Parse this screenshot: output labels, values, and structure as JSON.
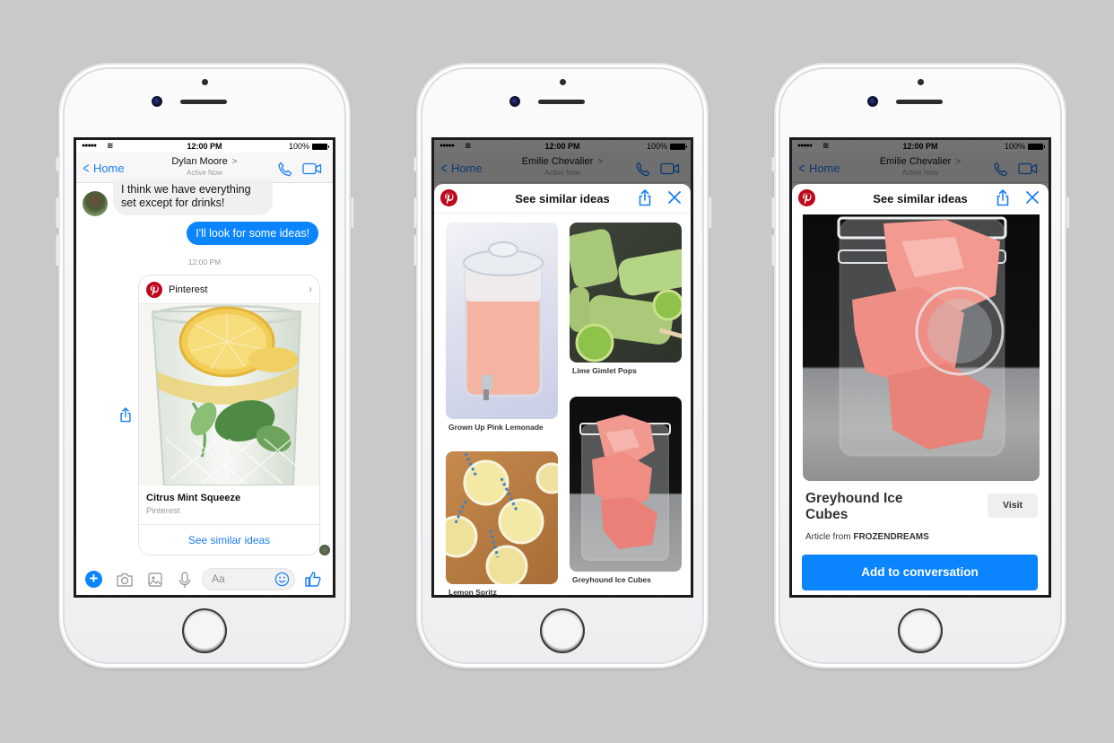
{
  "background_color": "#c9c9c9",
  "colors": {
    "messenger_blue": "#0a84ff",
    "link_blue": "#1a7ef4",
    "pinterest_red": "#bd081c",
    "bubble_gray": "#f1f0f0"
  },
  "phones": [
    {
      "status_bar": {
        "signal": "●●●●●",
        "wifi_icon": "wifi-icon",
        "time": "12:00 PM",
        "battery": "100%"
      },
      "nav": {
        "back_label": "Home",
        "contact_name": "Dylan Moore",
        "contact_arrow": ">",
        "status": "Active Now",
        "call_icon": "phone-icon",
        "video_icon": "video-camera-icon"
      },
      "messages": [
        {
          "direction": "incoming",
          "text": "I think we have everything set except for drinks!"
        },
        {
          "direction": "outgoing",
          "text": "I'll look for some ideas!"
        }
      ],
      "timestamp": "12:00 PM",
      "card": {
        "source_name": "Pinterest",
        "title": "Citrus Mint Squeeze",
        "subtitle": "Pinterest",
        "action_label": "See similar ideas",
        "image_description": "glass of water with lemon slices and mint leaves"
      },
      "composer": {
        "placeholder": "Aa",
        "icons": [
          "plus-icon",
          "camera-icon",
          "image-icon",
          "microphone-icon",
          "emoji-icon",
          "thumbs-up-icon"
        ]
      }
    },
    {
      "status_bar": {
        "signal": "●●●●●",
        "wifi_icon": "wifi-icon",
        "time": "12:00 PM",
        "battery": "100%"
      },
      "nav": {
        "back_label": "Home",
        "contact_name": "Emilie Chevalier",
        "contact_arrow": ">",
        "status": "Active Now"
      },
      "sheet": {
        "title": "See similar ideas",
        "pins": [
          {
            "label": "Grown Up Pink Lemonade",
            "image_description": "glass drink dispenser with pink lemonade"
          },
          {
            "label": "Lime Gimlet Pops",
            "image_description": "green popsicles with lime halves"
          },
          {
            "label": "Lemon Spritz",
            "image_description": "lemonade glasses with striped straws"
          },
          {
            "label": "Greyhound Ice Cubes",
            "image_description": "mason jar with pink ice cubes"
          }
        ]
      }
    },
    {
      "status_bar": {
        "signal": "●●●●●",
        "wifi_icon": "wifi-icon",
        "time": "12:00 PM",
        "battery": "100%"
      },
      "nav": {
        "back_label": "Home",
        "contact_name": "Emilie Chevalier",
        "contact_arrow": ">",
        "status": "Active Now"
      },
      "sheet": {
        "title": "See similar ideas",
        "detail": {
          "title": "Greyhound Ice Cubes",
          "visit_label": "Visit",
          "article_prefix": "Article from",
          "article_source": "FROZENDREAMS",
          "add_label": "Add to conversation",
          "image_description": "mason jar with pink ice cubes on wooden table"
        }
      }
    }
  ]
}
